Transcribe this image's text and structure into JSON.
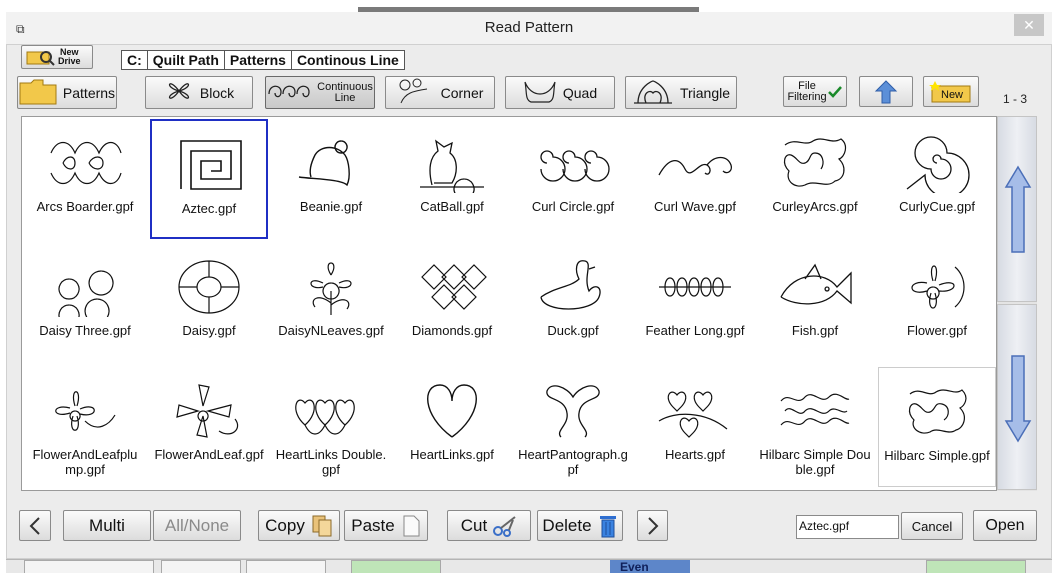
{
  "window": {
    "title": "Read Pattern",
    "close": "✕"
  },
  "toolbar": {
    "new_drive_label": "New\nDrive",
    "path_segments": [
      "C:",
      "Quilt Path",
      "Patterns",
      "Continous Line"
    ],
    "categories": [
      {
        "label": "Patterns",
        "icon": "folder-icon"
      },
      {
        "label": "Block",
        "icon": "block-motif-icon"
      },
      {
        "label": "Continuous\nLine",
        "icon": "continuous-line-icon",
        "active": true
      },
      {
        "label": "Corner",
        "icon": "corner-motif-icon"
      },
      {
        "label": "Quad",
        "icon": "quad-motif-icon"
      },
      {
        "label": "Triangle",
        "icon": "triangle-motif-icon"
      }
    ],
    "file_filtering_label": "File\nFiltering",
    "up_label": "up-arrow-icon",
    "new_label": "New",
    "page_count": "1 - 3"
  },
  "files": [
    {
      "name": "Arcs Boarder.gpf"
    },
    {
      "name": "Aztec.gpf",
      "selected": true
    },
    {
      "name": "Beanie.gpf"
    },
    {
      "name": "CatBall.gpf"
    },
    {
      "name": "Curl Circle.gpf"
    },
    {
      "name": "Curl Wave.gpf"
    },
    {
      "name": "CurleyArcs.gpf"
    },
    {
      "name": "CurlyCue.gpf"
    },
    {
      "name": "Daisy Three.gpf"
    },
    {
      "name": "Daisy.gpf"
    },
    {
      "name": "DaisyNLeaves.gpf"
    },
    {
      "name": "Diamonds.gpf"
    },
    {
      "name": "Duck.gpf"
    },
    {
      "name": "Feather Long.gpf"
    },
    {
      "name": "Fish.gpf"
    },
    {
      "name": "Flower.gpf"
    },
    {
      "name": "FlowerAndLeafplump.gpf"
    },
    {
      "name": "FlowerAndLeaf.gpf"
    },
    {
      "name": "HeartLinks Double.gpf"
    },
    {
      "name": "HeartLinks.gpf"
    },
    {
      "name": "HeartPantograph.gpf"
    },
    {
      "name": "Hearts.gpf"
    },
    {
      "name": "Hilbarc Simple Double.gpf"
    },
    {
      "name": "Hilbarc Simple.gpf",
      "hover": true
    }
  ],
  "bottom": {
    "multi": "Multi",
    "all_none": "All/None",
    "copy": "Copy",
    "paste": "Paste",
    "cut": "Cut",
    "delete": "Delete",
    "filename_value": "Aztec.gpf",
    "cancel": "Cancel",
    "open": "Open"
  },
  "background_app": {
    "even_label": "Even"
  },
  "colors": {
    "selection": "#1f2fc4",
    "scroll_arrow": "#5b7fd1"
  }
}
